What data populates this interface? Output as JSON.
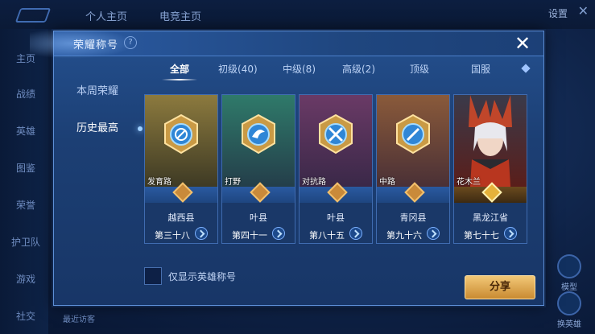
{
  "background": {
    "tabs": [
      "个人主页",
      "电竞主页"
    ],
    "settings_label": "设置",
    "side_items": [
      "主页",
      "战绩",
      "英雄",
      "图鉴",
      "荣誉",
      "护卫队",
      "游戏",
      "社交"
    ],
    "right_items": [
      "模型",
      "换英雄"
    ],
    "bottom_text": "最近访客"
  },
  "dialog": {
    "title": "荣耀称号",
    "help_icon": "?",
    "close_icon": "✕",
    "side_menu": [
      "本周荣耀",
      "历史最高"
    ],
    "active_side": "历史最高",
    "tabs": [
      {
        "label": "全部",
        "active": true
      },
      {
        "label": "初级(40)",
        "active": false
      },
      {
        "label": "中级(8)",
        "active": false
      },
      {
        "label": "高级(2)",
        "active": false
      },
      {
        "label": "顶级",
        "active": false
      },
      {
        "label": "国服",
        "active": false
      }
    ],
    "cards": [
      {
        "role": "发育路",
        "region": "越西县",
        "rank": "第三十八",
        "theme": "gold",
        "icon": "clock-emblem-icon"
      },
      {
        "role": "打野",
        "region": "叶县",
        "rank": "第四十一",
        "theme": "green",
        "icon": "dragon-emblem-icon"
      },
      {
        "role": "对抗路",
        "region": "叶县",
        "rank": "第八十五",
        "theme": "purple",
        "icon": "crossed-swords-emblem-icon"
      },
      {
        "role": "中路",
        "region": "青冈县",
        "rank": "第九十六",
        "theme": "orange",
        "icon": "sword-emblem-icon"
      },
      {
        "role": "花木兰",
        "region": "黑龙江省",
        "rank": "第七十七",
        "theme": "hero",
        "icon": "hero-portrait"
      }
    ],
    "checkbox_label": "仅显示英雄称号",
    "share_label": "分享"
  }
}
